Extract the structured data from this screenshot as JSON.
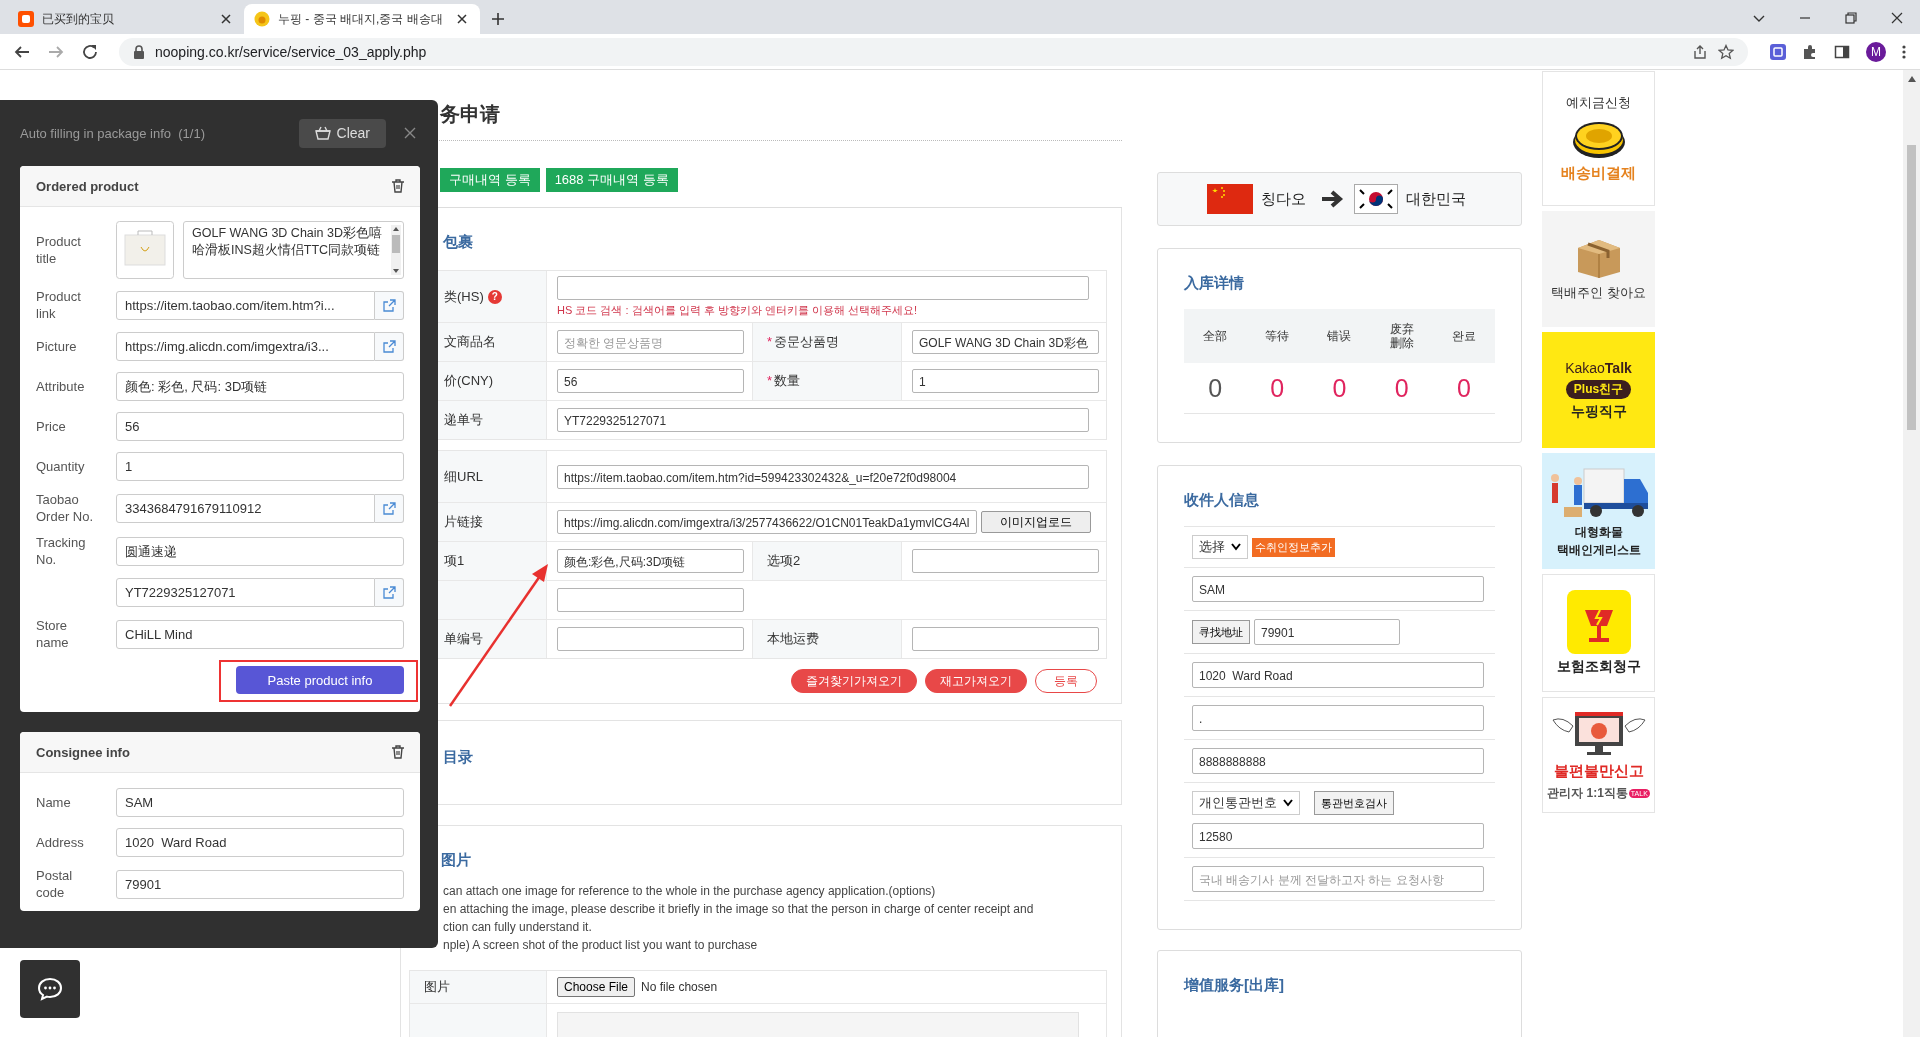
{
  "browser": {
    "tabs": [
      {
        "title": "已买到的宝贝",
        "selected": false
      },
      {
        "title": "누핑 - 중국 배대지,중국 배송대",
        "selected": true
      }
    ],
    "url": "nooping.co.kr/service/service_03_apply.php",
    "profile_initial": "M"
  },
  "main": {
    "title": "务申请",
    "top_buttons": [
      "구매내역 등록",
      "1688 구매내역 등록"
    ],
    "package": {
      "heading": "包裹",
      "tables": [
        [
          {
            "kind": "wide",
            "label": "类(HS)",
            "help": "?",
            "hint": "HS 코드 검색 : 검색어를 입력 후 방향키와 엔터키를 이용해 선택해주세요!"
          },
          {
            "kind": "pair",
            "label": "文商品名",
            "field": {
              "placeholder": "정확한 영문상품명"
            },
            "label2": "중문상품명",
            "required2": "*",
            "field2": {
              "value": "GOLF WANG 3D Chain 3D彩色"
            }
          },
          {
            "kind": "pair",
            "label": "价(CNY)",
            "field": {
              "value": "56"
            },
            "label2": "数量",
            "required2": "*",
            "field2": {
              "value": "1"
            }
          },
          {
            "kind": "wide",
            "label": "递单号",
            "field": {
              "value": "YT7229325127071"
            }
          }
        ],
        [
          {
            "kind": "wide",
            "label": "细URL",
            "field": {
              "value": "https://item.taobao.com/item.htm?id=599423302432&_u=f20e72f0d98004"
            }
          },
          {
            "kind": "wide",
            "label": "片链接",
            "field": {
              "value": "https://img.alicdn.com/imgextra/i3/2577436622/O1CN01TeakDa1ymvlCG4Al"
            },
            "button": "이미지업로드"
          },
          {
            "kind": "pair",
            "label": "项1",
            "field": {
              "value": "颜色:彩色,尺码:3D项链"
            },
            "label2": "选项2"
          },
          {
            "kind": "single"
          },
          {
            "kind": "pair",
            "label": "单编号",
            "label2": "本地运费"
          }
        ]
      ],
      "actions": [
        {
          "label": "즐겨찾기가져오기",
          "kind": "primary"
        },
        {
          "label": "재고가져오기",
          "kind": "primary"
        },
        {
          "label": "등록",
          "kind": "secondary"
        }
      ]
    },
    "catalog": {
      "heading": "目录"
    },
    "images": {
      "heading": "图片",
      "notes": [
        "can attach one image for reference to the whole in the purchase agency application.(options)",
        "en attaching the image, please describe it briefly in the image so that the person in charge of center receipt and",
        "ction can fully understand it.",
        "nple) A screen shot of the product list you want to purchase"
      ],
      "label": "图片",
      "file_button": "Choose File",
      "file_status": "No file chosen"
    }
  },
  "right": {
    "route": {
      "from": "칭다오",
      "to": "대한민국"
    },
    "stock": {
      "heading": "入库详情",
      "items": [
        {
          "label": "全部",
          "value": "0",
          "color": "#555555"
        },
        {
          "label": "等待",
          "value": "0",
          "color": "#e0245e"
        },
        {
          "label": "错误",
          "value": "0",
          "color": "#e0245e"
        },
        {
          "label": "废弃删除",
          "value": "0",
          "color": "#e0245e"
        },
        {
          "label": "완료",
          "value": "0",
          "color": "#e0245e"
        }
      ]
    },
    "recipient": {
      "heading": "收件人信息",
      "rows": [
        {
          "kind": "select_badge",
          "select": "选择",
          "badge": "수취인정보추가"
        },
        {
          "kind": "field",
          "field": {
            "value": "SAM"
          }
        },
        {
          "kind": "button_field",
          "button": "寻找地址",
          "field": {
            "value": "79901"
          }
        },
        {
          "kind": "field",
          "field": {
            "value": "1020  Ward Road"
          }
        },
        {
          "kind": "field",
          "field": {
            "value": "."
          }
        },
        {
          "kind": "field",
          "field": {
            "value": "8888888888"
          }
        },
        {
          "kind": "select_button_field",
          "select": "개인통관번호",
          "button": "통관번호검사",
          "field": {
            "value": "12580"
          }
        },
        {
          "kind": "field",
          "field": {
            "placeholder": "국내 배송기사 분께 전달하고자 하는 요청사항"
          }
        }
      ]
    },
    "services": {
      "heading": "增值服务[出库]"
    }
  },
  "side_banners": [
    {
      "kind": "deposit",
      "lines": [
        "예치금신청",
        "배송비결제"
      ]
    },
    {
      "kind": "box",
      "lines": [
        "택배주인 찾아요"
      ]
    },
    {
      "kind": "kakao",
      "lines": [
        "Kakao**Talk**",
        "Plus친구",
        "누핑직구"
      ]
    },
    {
      "kind": "truck",
      "lines": [
        "대형화물",
        "택배인게리스트"
      ]
    },
    {
      "kind": "insurance",
      "lines": [
        "보험조회청구"
      ]
    },
    {
      "kind": "complaint",
      "lines": [
        "불편불만신고",
        "관리자 1:1직통"
      ],
      "badge": "TALK"
    }
  ],
  "autofill_panel": {
    "title": "Auto filling in package info",
    "count": "(1/1)",
    "clear_button": "Clear",
    "product": {
      "heading": "Ordered product",
      "title_label": "Product title",
      "title_value": "GOLF WANG 3D Chain 3D彩色嘻哈滑板INS超火情侣TTC同款项链",
      "fields": [
        {
          "label": "Product link",
          "value": "https://item.taobao.com/item.htm?i...",
          "link": true
        },
        {
          "label": "Picture",
          "value": "https://img.alicdn.com/imgextra/i3...",
          "link": true
        },
        {
          "label": "Attribute",
          "value": "颜色: 彩色, 尺码: 3D项链",
          "link": false
        },
        {
          "label": "Price",
          "value": "56",
          "link": false
        },
        {
          "label": "Quantity",
          "value": "1",
          "link": false
        },
        {
          "label": "Taobao Order No.",
          "value": "3343684791679110912",
          "link": true
        },
        {
          "label": "Tracking No.",
          "value": "圆通速递",
          "link": false
        },
        {
          "value": "YT7229325127071",
          "link": true
        },
        {
          "label": "Store name",
          "value": "CHiLL Mind",
          "link": false
        }
      ],
      "paste_button": "Paste product info"
    },
    "consignee": {
      "heading": "Consignee info",
      "fields": [
        {
          "label": "Name",
          "value": "SAM"
        },
        {
          "label": "Address",
          "value": "1020  Ward Road"
        },
        {
          "label": "Postal code",
          "value": "79901"
        }
      ]
    }
  }
}
